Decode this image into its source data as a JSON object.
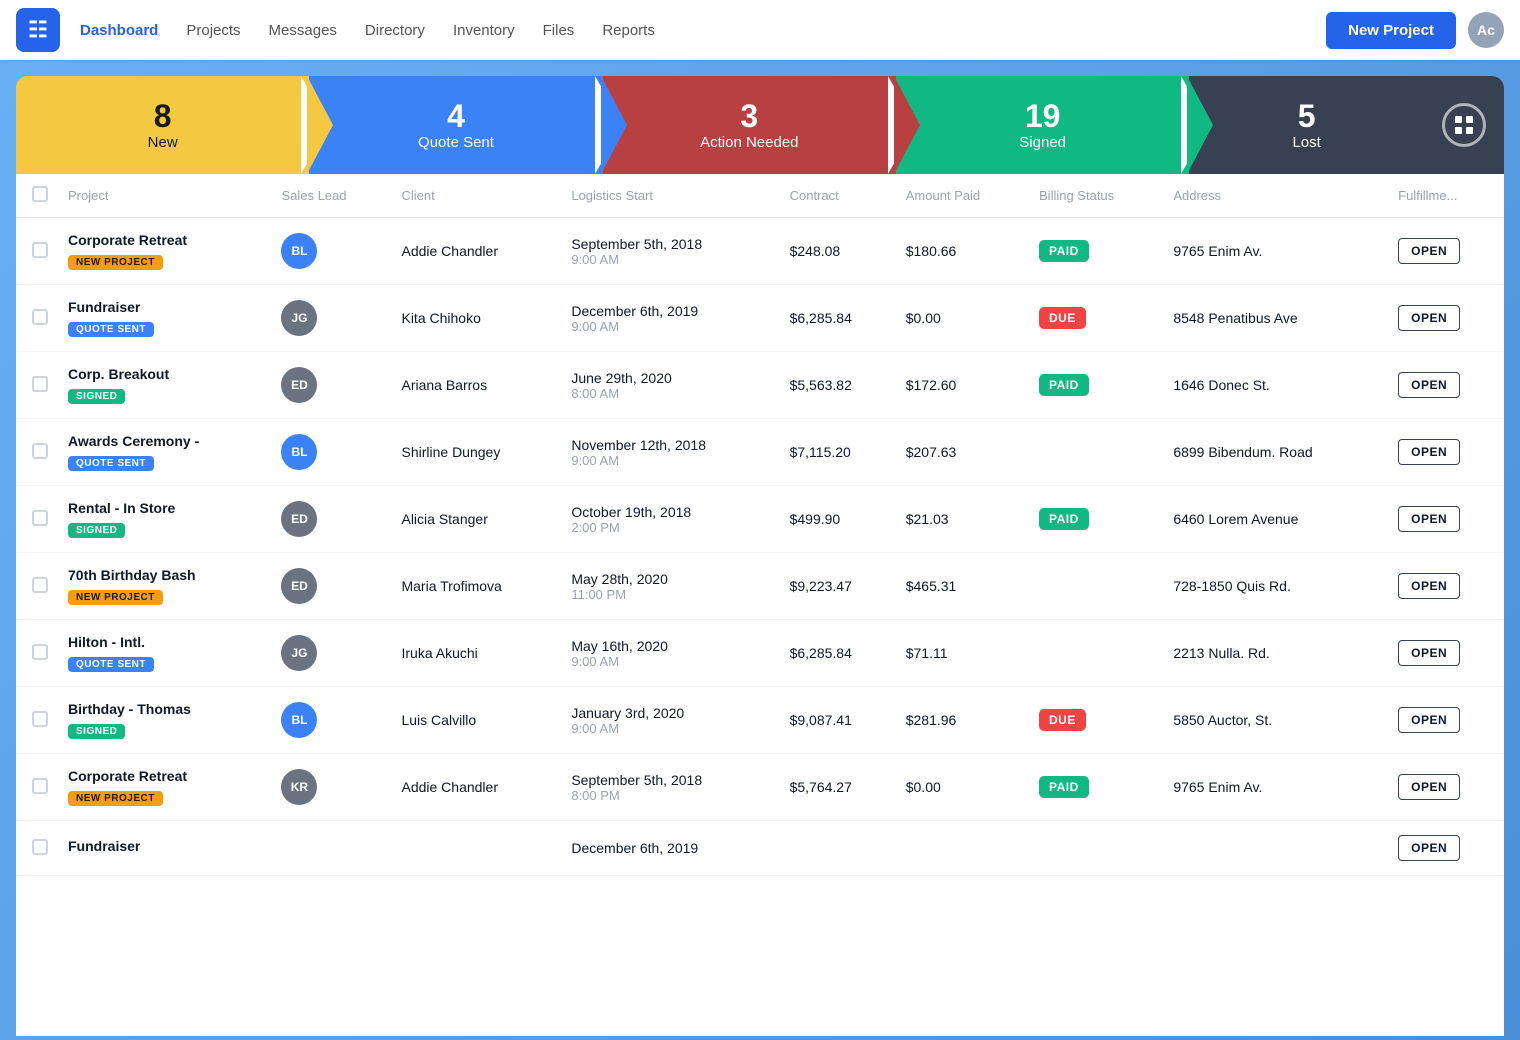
{
  "nav": {
    "links": [
      {
        "label": "Dashboard",
        "active": true
      },
      {
        "label": "Projects",
        "active": false
      },
      {
        "label": "Messages",
        "active": false
      },
      {
        "label": "Directory",
        "active": false
      },
      {
        "label": "Inventory",
        "active": false
      },
      {
        "label": "Files",
        "active": false
      },
      {
        "label": "Reports",
        "active": false
      }
    ],
    "new_project_label": "New Project",
    "account_initials": "Ac"
  },
  "pipeline": [
    {
      "count": "8",
      "label": "New",
      "class": "step-new"
    },
    {
      "count": "4",
      "label": "Quote Sent",
      "class": "step-quote"
    },
    {
      "count": "3",
      "label": "Action Needed",
      "class": "step-action"
    },
    {
      "count": "19",
      "label": "Signed",
      "class": "step-signed"
    },
    {
      "count": "5",
      "label": "Lost",
      "class": "step-lost"
    }
  ],
  "table": {
    "columns": [
      "",
      "Project",
      "Sales Lead",
      "Client",
      "Logistics Start",
      "Contract",
      "Amount Paid",
      "Billing Status",
      "Address",
      "Fulfillme..."
    ],
    "rows": [
      {
        "project_name": "Corporate Retreat",
        "badge": "NEW PROJECT",
        "badge_class": "badge-new",
        "avatar_initials": "BL",
        "avatar_bg": "#3b82f6",
        "client": "Addie Chandler",
        "logistics_date": "September 5th, 2018",
        "logistics_time": "9:00 AM",
        "contract": "$248.08",
        "amount_paid": "$180.66",
        "billing": "PAID",
        "billing_class": "billing-paid",
        "address": "9765 Enim Av.",
        "open": "OPEN"
      },
      {
        "project_name": "Fundraiser",
        "badge": "QUOTE SENT",
        "badge_class": "badge-quote",
        "avatar_initials": "JG",
        "avatar_bg": "#6b7280",
        "client": "Kita Chihoko",
        "logistics_date": "December 6th, 2019",
        "logistics_time": "9:00 AM",
        "contract": "$6,285.84",
        "amount_paid": "$0.00",
        "billing": "DUE",
        "billing_class": "billing-due",
        "address": "8548 Penatibus Ave",
        "open": "OPEN"
      },
      {
        "project_name": "Corp. Breakout",
        "badge": "SIGNED",
        "badge_class": "badge-signed",
        "avatar_initials": "ED",
        "avatar_bg": "#6b7280",
        "client": "Ariana Barros",
        "logistics_date": "June 29th, 2020",
        "logistics_time": "8:00 AM",
        "contract": "$5,563.82",
        "amount_paid": "$172.60",
        "billing": "PAID",
        "billing_class": "billing-paid",
        "address": "1646 Donec St.",
        "open": "OPEN"
      },
      {
        "project_name": "Awards Ceremony -",
        "badge": "QUOTE SENT",
        "badge_class": "badge-quote",
        "avatar_initials": "BL",
        "avatar_bg": "#3b82f6",
        "client": "Shirline Dungey",
        "logistics_date": "November 12th, 2018",
        "logistics_time": "9:00 AM",
        "contract": "$7,115.20",
        "amount_paid": "$207.63",
        "billing": "",
        "billing_class": "",
        "address": "6899 Bibendum. Road",
        "open": "OPEN"
      },
      {
        "project_name": "Rental - In Store",
        "badge": "SIGNED",
        "badge_class": "badge-signed",
        "avatar_initials": "ED",
        "avatar_bg": "#6b7280",
        "client": "Alicia Stanger",
        "logistics_date": "October 19th, 2018",
        "logistics_time": "2:00 PM",
        "contract": "$499.90",
        "amount_paid": "$21.03",
        "billing": "PAID",
        "billing_class": "billing-paid",
        "address": "6460 Lorem Avenue",
        "open": "OPEN"
      },
      {
        "project_name": "70th Birthday Bash",
        "badge": "NEW PROJECT",
        "badge_class": "badge-new",
        "avatar_initials": "ED",
        "avatar_bg": "#6b7280",
        "client": "Maria Trofimova",
        "logistics_date": "May 28th, 2020",
        "logistics_time": "11:00 PM",
        "contract": "$9,223.47",
        "amount_paid": "$465.31",
        "billing": "",
        "billing_class": "",
        "address": "728-1850 Quis Rd.",
        "open": "OPEN"
      },
      {
        "project_name": "Hilton - Intl.",
        "badge": "QUOTE SENT",
        "badge_class": "badge-quote",
        "avatar_initials": "JG",
        "avatar_bg": "#6b7280",
        "client": "Iruka Akuchi",
        "logistics_date": "May 16th, 2020",
        "logistics_time": "9:00 AM",
        "contract": "$6,285.84",
        "amount_paid": "$71.11",
        "billing": "",
        "billing_class": "",
        "address": "2213 Nulla. Rd.",
        "open": "OPEN"
      },
      {
        "project_name": "Birthday - Thomas",
        "badge": "SIGNED",
        "badge_class": "badge-signed",
        "avatar_initials": "BL",
        "avatar_bg": "#3b82f6",
        "client": "Luis Calvillo",
        "logistics_date": "January 3rd, 2020",
        "logistics_time": "9:00 AM",
        "contract": "$9,087.41",
        "amount_paid": "$281.96",
        "billing": "DUE",
        "billing_class": "billing-due",
        "address": "5850 Auctor, St.",
        "open": "OPEN"
      },
      {
        "project_name": "Corporate Retreat",
        "badge": "NEW PROJECT",
        "badge_class": "badge-new",
        "avatar_initials": "KR",
        "avatar_bg": "#6b7280",
        "client": "Addie Chandler",
        "logistics_date": "September 5th, 2018",
        "logistics_time": "8:00 PM",
        "contract": "$5,764.27",
        "amount_paid": "$0.00",
        "billing": "PAID",
        "billing_class": "billing-paid",
        "address": "9765 Enim Av.",
        "open": "OPEN"
      },
      {
        "project_name": "Fundraiser",
        "badge": "",
        "badge_class": "",
        "avatar_initials": "",
        "avatar_bg": "#6b7280",
        "client": "",
        "logistics_date": "December 6th, 2019",
        "logistics_time": "",
        "contract": "",
        "amount_paid": "",
        "billing": "",
        "billing_class": "",
        "address": "",
        "open": "OPEN"
      }
    ]
  }
}
